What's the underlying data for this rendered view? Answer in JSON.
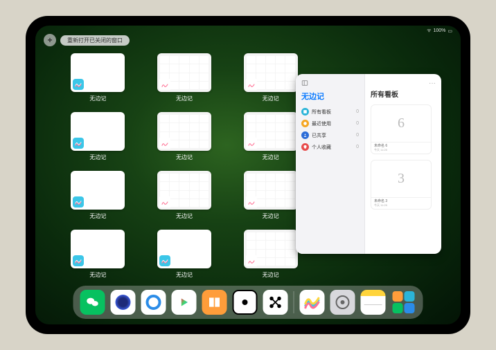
{
  "status": {
    "wifi": "●",
    "battery_pct": "100%"
  },
  "topbar": {
    "add_label": "+",
    "reopen_label": "重新打开已关闭的窗口"
  },
  "app_switcher": {
    "app_name": "无边记",
    "thumbs": [
      {
        "type": "blank"
      },
      {
        "type": "cal"
      },
      {
        "type": "cal"
      },
      {
        "type": "blank"
      },
      {
        "type": "cal"
      },
      {
        "type": "cal"
      },
      {
        "type": "blank"
      },
      {
        "type": "cal"
      },
      {
        "type": "cal"
      },
      {
        "type": "blank"
      },
      {
        "type": "blank"
      },
      {
        "type": "cal"
      }
    ]
  },
  "panel": {
    "sidebar_title": "无边记",
    "items": [
      {
        "icon_color": "#2bb4d8",
        "label": "所有看板",
        "count": 0
      },
      {
        "icon_color": "#f5a623",
        "label": "最近使用",
        "count": 0
      },
      {
        "icon_color": "#2b6cd8",
        "label": "已共享",
        "count": 0
      },
      {
        "icon_color": "#e84c4c",
        "label": "个人收藏",
        "count": 0
      }
    ],
    "main_title": "所有看板",
    "more": "···",
    "boards": [
      {
        "preview": "6",
        "title": "未命名 6",
        "time": "今天 11:25"
      },
      {
        "preview": "3",
        "title": "未命名 3",
        "time": "今天 11:25"
      }
    ]
  },
  "dock": {
    "items": [
      {
        "name": "wechat",
        "bg": "#07c160",
        "glyph": "✶"
      },
      {
        "name": "quark",
        "bg": "#fff",
        "glyph": "◉"
      },
      {
        "name": "qqbrowser",
        "bg": "#fff",
        "glyph": "◯"
      },
      {
        "name": "youku",
        "bg": "#fff",
        "glyph": "▶"
      },
      {
        "name": "books",
        "bg": "#ff9d3a",
        "glyph": "▮▮"
      },
      {
        "name": "dice",
        "bg": "#fff",
        "glyph": "⊡"
      },
      {
        "name": "mindnode",
        "bg": "#fff",
        "glyph": "⌘"
      },
      {
        "name": "freeform",
        "bg": "#fff",
        "glyph": "〰"
      },
      {
        "name": "settings",
        "bg": "#d8d8dc",
        "glyph": "⚙"
      },
      {
        "name": "notes",
        "bg": "#fff",
        "glyph": "▤"
      }
    ]
  }
}
